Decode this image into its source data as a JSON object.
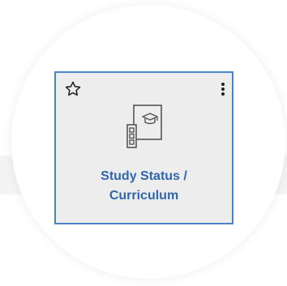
{
  "tile": {
    "label_line1": "Study Status /",
    "label_line2": "Curriculum",
    "icon": "study-curriculum-icon",
    "favorite_icon": "star-outline-icon",
    "menu_icon": "more-vertical-icon"
  },
  "colors": {
    "border": "#4b84c9",
    "label": "#2f66b0",
    "tile_bg": "#ededed",
    "icon_stroke": "#555555"
  }
}
